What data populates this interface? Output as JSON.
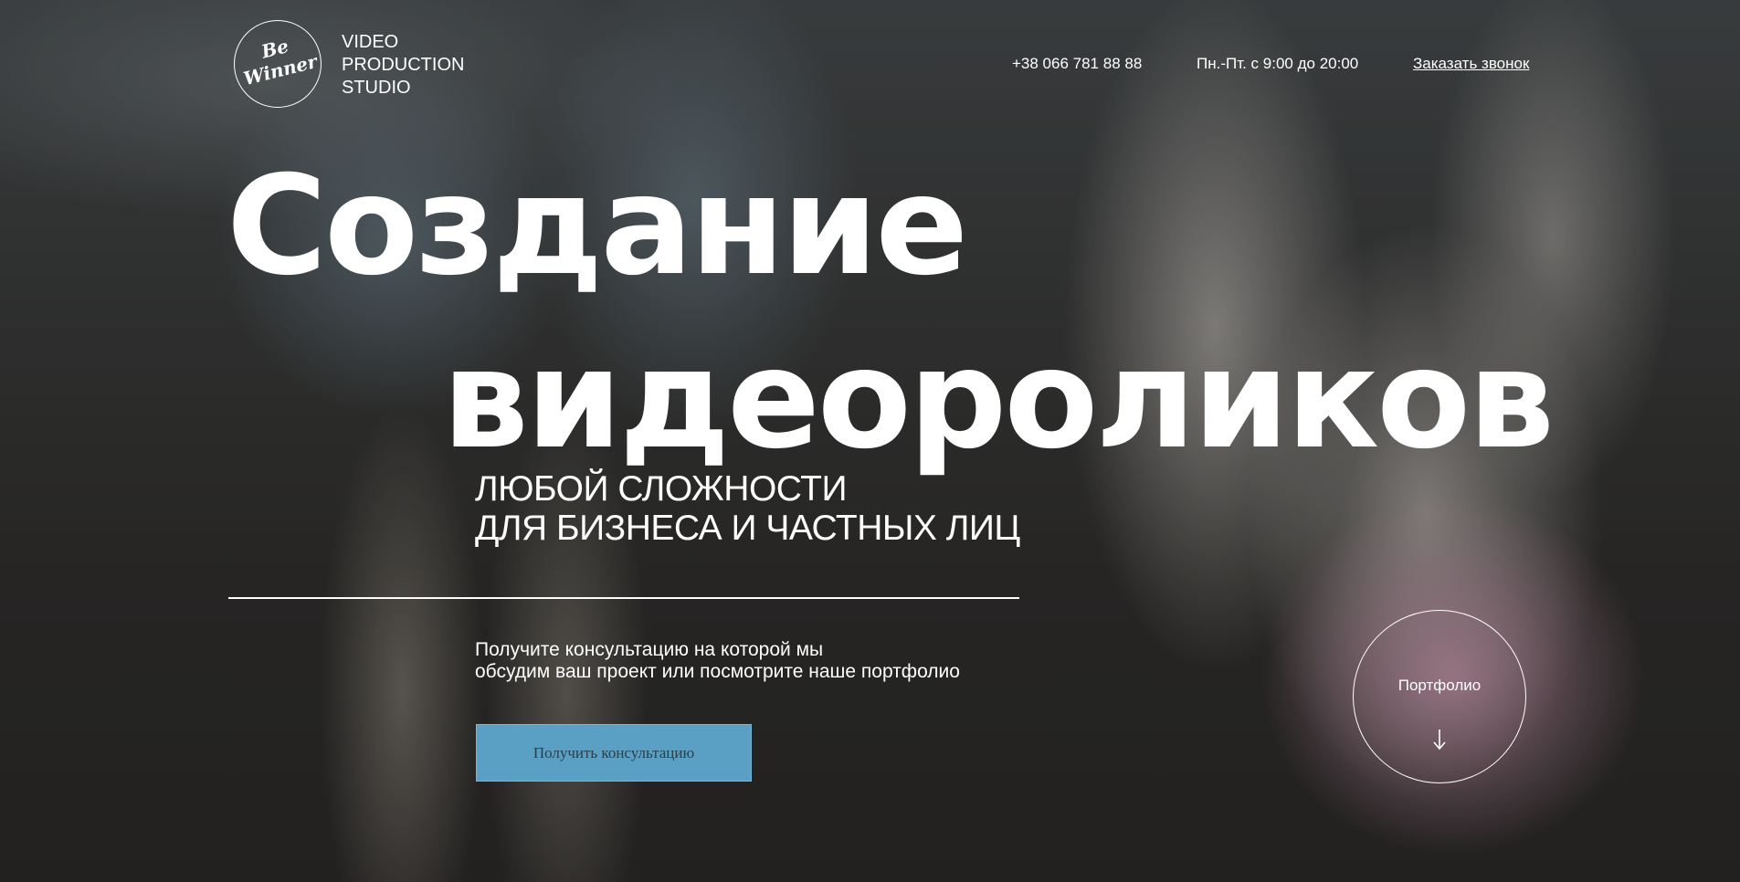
{
  "header": {
    "logo_text": "Be Winner",
    "studio_lines": [
      "VIDEO",
      "PRODUCTION",
      "STUDIO"
    ],
    "phone": "+38 066 781 88 88",
    "hours": "Пн.-Пт. с 9:00 до 20:00",
    "callback_label": "Заказать звонок"
  },
  "hero": {
    "title_line1": "Создание",
    "title_line2": "видеороликов",
    "subtitle_line1": "ЛЮБОЙ СЛОЖНОСТИ",
    "subtitle_line2": "ДЛЯ БИЗНЕСА И ЧАСТНЫХ ЛИЦ",
    "cta_line1": "Получите консультацию на которой мы",
    "cta_line2": "обсудим ваш проект или посмотрите наше портфолио",
    "cta_button_label": "Получить консультацию",
    "cta_button_color": "#5aa0c4",
    "portfolio_label": "Портфолио",
    "portfolio_icon": "arrow-down-icon"
  }
}
